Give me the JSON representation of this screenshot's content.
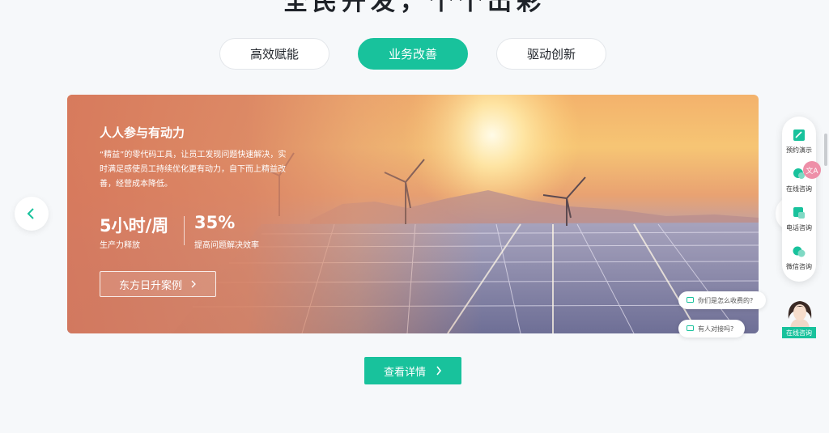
{
  "section": {
    "title": "全民开发，个个出彩"
  },
  "tabs": [
    {
      "label": "高效赋能",
      "active": false
    },
    {
      "label": "业务改善",
      "active": true
    },
    {
      "label": "驱动创新",
      "active": false
    }
  ],
  "banner": {
    "title": "人人参与有动力",
    "description": "“精益”的零代码工具，让员工发现问题快速解决，实时满足感使员工持续优化更有动力，自下而上精益改善，经营成本降低。",
    "stats": [
      {
        "value": "5小时/周",
        "label": "生产力释放"
      },
      {
        "value": "35%",
        "label": "提高问题解决效率"
      }
    ],
    "case_button": "东方日升案例"
  },
  "detail_button": "查看详情",
  "side_panel": {
    "items": [
      {
        "label": "预约演示",
        "icon": "calendar-icon"
      },
      {
        "label": "在线咨询",
        "icon": "chat-icon"
      },
      {
        "label": "电话咨询",
        "icon": "phone-icon"
      },
      {
        "label": "微信咨询",
        "icon": "wechat-icon"
      }
    ]
  },
  "bubbles": [
    {
      "text": "你们是怎么收费的?"
    },
    {
      "text": "有人对接吗?"
    }
  ],
  "avatar": {
    "label": "在线咨询"
  },
  "colors": {
    "accent": "#18c29c"
  }
}
